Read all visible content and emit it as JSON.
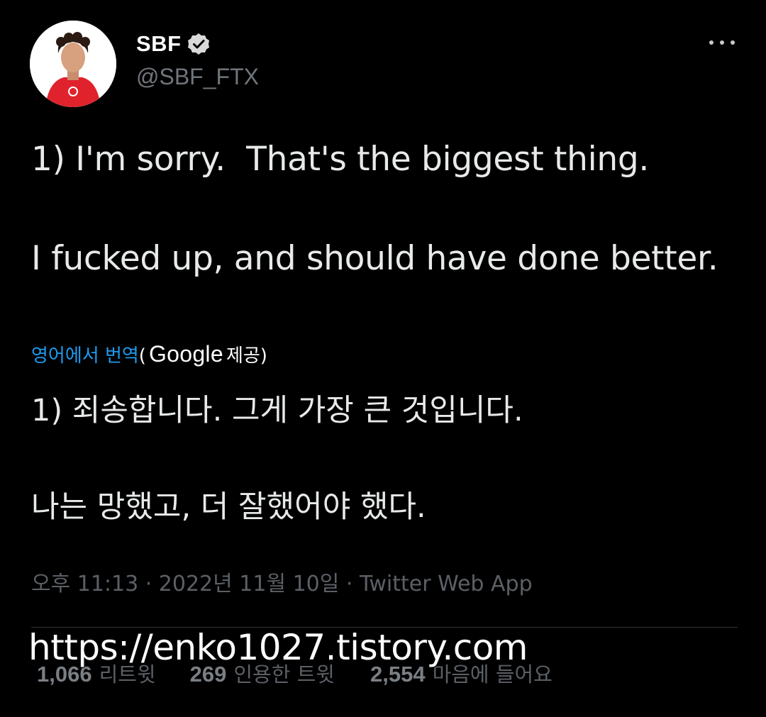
{
  "user": {
    "display_name": "SBF",
    "handle": "@SBF_FTX",
    "verified": true
  },
  "icons": {
    "avatar": "profile-photo",
    "verified": "verified-badge-icon",
    "more": "more-options-icon"
  },
  "tweet": {
    "text": "1) I'm sorry.  That's the biggest thing.\n\nI fucked up, and should have done better.",
    "translate_link": "영어에서 번역",
    "translate_provider_open": "(",
    "translate_provider_name": "Google",
    "translate_provider_suffix": " 제공)",
    "translated_text": "1) 죄송합니다. 그게 가장 큰 것입니다.\n\n나는 망했고, 더 잘했어야 했다.",
    "timestamp": "오후 11:13 · 2022년 11월 10일 · ",
    "source_app": "Twitter Web App"
  },
  "stats": {
    "retweets_count": "1,066",
    "retweets_label": "리트윗",
    "quotes_count": "269",
    "quotes_label": "인용한 트윗",
    "likes_count": "2,554",
    "likes_label": "마음에 들어요"
  },
  "watermark": "https://enko1027.tistory.com",
  "colors": {
    "background": "#000000",
    "link": "#1d9bf0",
    "muted": "#71767b",
    "text": "#e7e9ea"
  }
}
